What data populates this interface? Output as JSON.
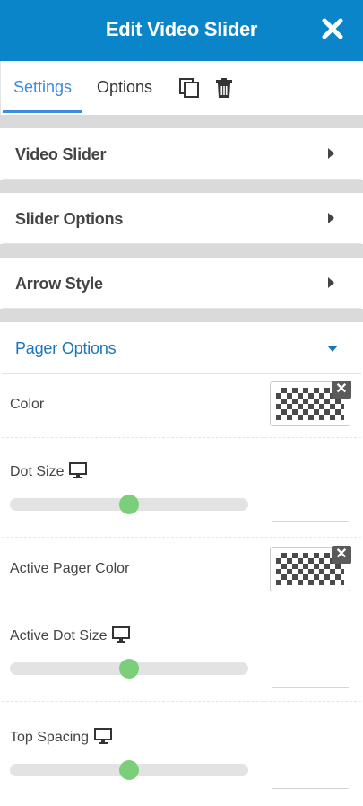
{
  "header": {
    "title": "Edit Video Slider",
    "close_icon": "close-icon",
    "background": "#0a85c9"
  },
  "tabs": [
    {
      "label": "Settings",
      "active": true
    },
    {
      "label": "Options",
      "active": false
    }
  ],
  "tab_icons": [
    "copy-icon",
    "trash-icon"
  ],
  "accent": "#3d8be0",
  "sections": [
    {
      "title": "Video Slider",
      "expanded": false
    },
    {
      "title": "Slider Options",
      "expanded": false
    },
    {
      "title": "Arrow Style",
      "expanded": false
    },
    {
      "title": "Pager Options",
      "expanded": true
    }
  ],
  "pager_options": {
    "color": {
      "label": "Color"
    },
    "dot_size": {
      "label": "Dot Size",
      "icon": "monitor-icon",
      "level": 0.5,
      "value": ""
    },
    "active_pager_color": {
      "label": "Active Pager Color"
    },
    "active_dot_size": {
      "label": "Active Dot Size",
      "icon": "monitor-icon",
      "level": 0.5,
      "value": ""
    },
    "top_spacing": {
      "label": "Top Spacing",
      "icon": "monitor-icon",
      "level": 0.5,
      "value": ""
    }
  },
  "slider_thumb_color": "#7bcf7b"
}
